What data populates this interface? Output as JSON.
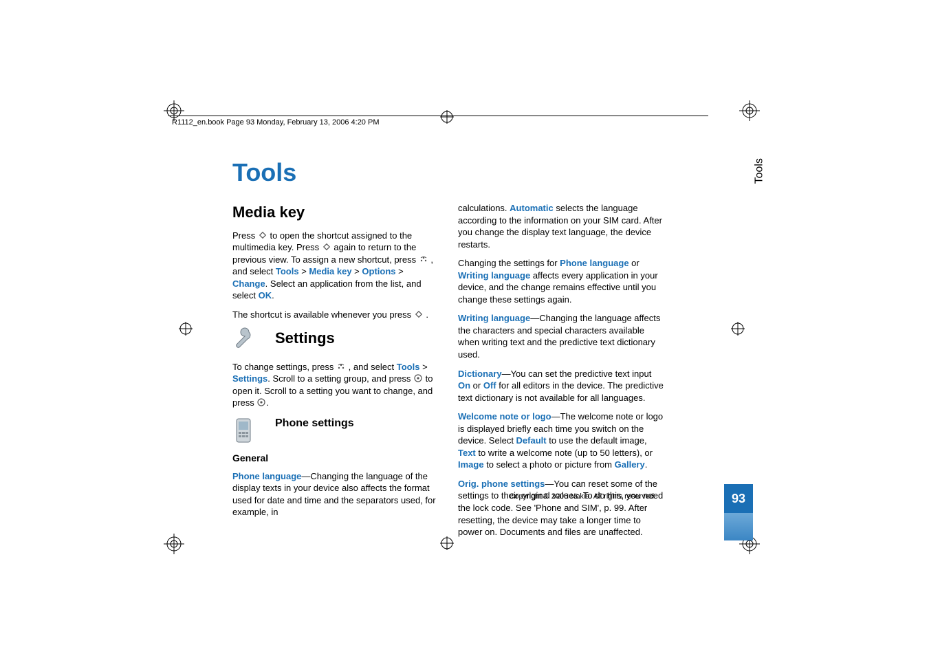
{
  "header": {
    "running": "R1112_en.book  Page 93  Monday, February 13, 2006  4:20 PM"
  },
  "chapter_title": "Tools",
  "side_tab": "Tools",
  "page_number": "93",
  "copyright": "Copyright © 2006 Nokia. All rights reserved.",
  "left": {
    "media_key_heading": "Media key",
    "p1a": "Press ",
    "p1b": " to open the shortcut assigned to the multimedia key. Press ",
    "p1c": " again to return to the previous view. To assign a new shortcut, press ",
    "p1d": " , and select ",
    "p1_tools": "Tools",
    "p1_media_key": "Media key",
    "p1_options": "Options",
    "p1_change": "Change",
    "p1e": ". Select an application from the list, and select ",
    "p1_ok": "OK",
    "p1f": ".",
    "p2a": "The shortcut is available whenever you press ",
    "p2b": " .",
    "settings_heading": "Settings",
    "p3a": "To change settings, press ",
    "p3b": " , and select ",
    "p3_tools": "Tools",
    "p3_settings": "Settings",
    "p3c": ". Scroll to a setting group, and press ",
    "p3d": " to open it. Scroll to a setting you want to change, and press ",
    "p3e": ".",
    "phone_settings_heading": "Phone settings",
    "general_heading": "General",
    "p4_phone_language": "Phone language",
    "p4a": "—Changing the language of the display texts in your device also affects the format used for date and time and the separators used, for example, in "
  },
  "right": {
    "r1a": "calculations. ",
    "r1_automatic": "Automatic",
    "r1b": " selects the language according to the information on your SIM card. After you change the display text language, the device restarts.",
    "r2a": "Changing the settings for ",
    "r2_phone_language": "Phone language",
    "r2b": " or ",
    "r2_writing_language": "Writing language",
    "r2c": " affects every application in your device, and the change remains effective until you change these settings again.",
    "r3_writing_language": "Writing language",
    "r3a": "—Changing the language affects the characters and special characters available when writing text and the predictive text dictionary used.",
    "r4_dictionary": "Dictionary",
    "r4a": "—You can set the predictive text input ",
    "r4_on": "On",
    "r4b": " or ",
    "r4_off": "Off",
    "r4c": " for all editors in the device. The predictive text dictionary is not available for all languages.",
    "r5_welcome": "Welcome note or logo",
    "r5a": "—The welcome note or logo is displayed briefly each time you switch on the device. Select ",
    "r5_default": "Default",
    "r5b": " to use the default image, ",
    "r5_text": "Text",
    "r5c": " to write a welcome note (up to 50 letters), or ",
    "r5_image": "Image",
    "r5d": " to select a photo or picture from ",
    "r5_gallery": "Gallery",
    "r5e": ".",
    "r6_orig": "Orig. phone settings",
    "r6a": "—You can reset some of the settings to their original values. To do this, you need the lock code. See 'Phone and SIM', p. 99. After resetting, the device may take a longer time to power on. Documents and files are unaffected."
  }
}
